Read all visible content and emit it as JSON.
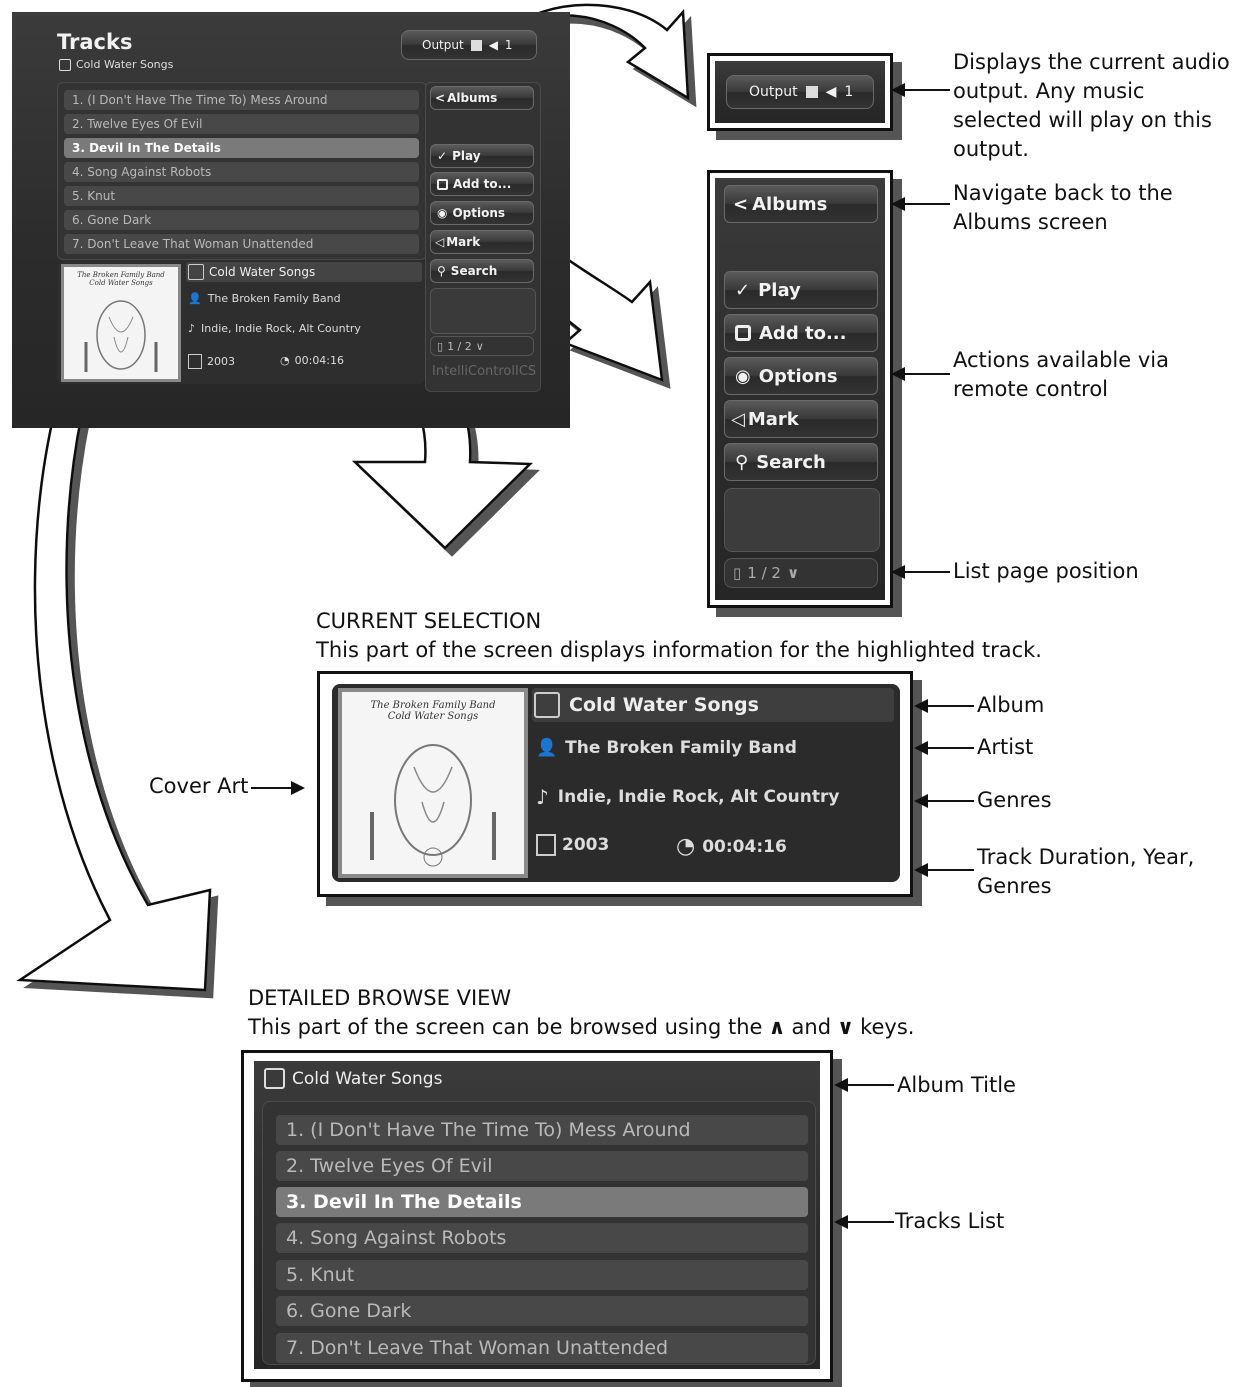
{
  "screen": {
    "title": "Tracks",
    "subtitle": "Cold Water Songs",
    "output": {
      "label": "Output",
      "number": "1"
    },
    "tracks": [
      "1. (I Don't Have The Time To) Mess Around",
      "2. Twelve Eyes Of Evil",
      "3. Devil In The Details",
      "4. Song Against Robots",
      "5. Knut",
      "6. Gone Dark",
      "7. Don't Leave That Woman Unattended"
    ],
    "selected_index": 2,
    "buttons": {
      "albums": "Albums",
      "play": "Play",
      "add_to": "Add to...",
      "options": "Options",
      "mark": "Mark",
      "search": "Search"
    },
    "page_position": "1 / 2",
    "brand": "IntelliControlICS",
    "selection": {
      "album": "Cold Water Songs",
      "artist": "The Broken Family Band",
      "genres": "Indie, Indie Rock, Alt Country",
      "year": "2003",
      "duration": "00:04:16",
      "cover_text": [
        "The Broken Family Band",
        "Cold Water Songs"
      ]
    }
  },
  "annotations": {
    "output": "Displays the current audio output.  Any music selected will play on this output.",
    "albums": "Navigate back to the Albums screen",
    "actions": "Actions available via remote control",
    "page": "List page position",
    "album": "Album",
    "artist": "Artist",
    "genres": "Genres",
    "duration": "Track Duration, Year, Genres",
    "cover_art": "Cover Art",
    "album_title": "Album Title",
    "tracks_list": "Tracks List"
  },
  "sections": {
    "current_selection_heading": "CURRENT SELECTION",
    "current_selection_desc": "This part of the screen displays information for the highlighted track.",
    "browse_heading": "DETAILED BROWSE VIEW",
    "browse_desc_before": "This part of the screen can be browsed using the",
    "browse_desc_and": "and",
    "browse_desc_after": "keys."
  }
}
